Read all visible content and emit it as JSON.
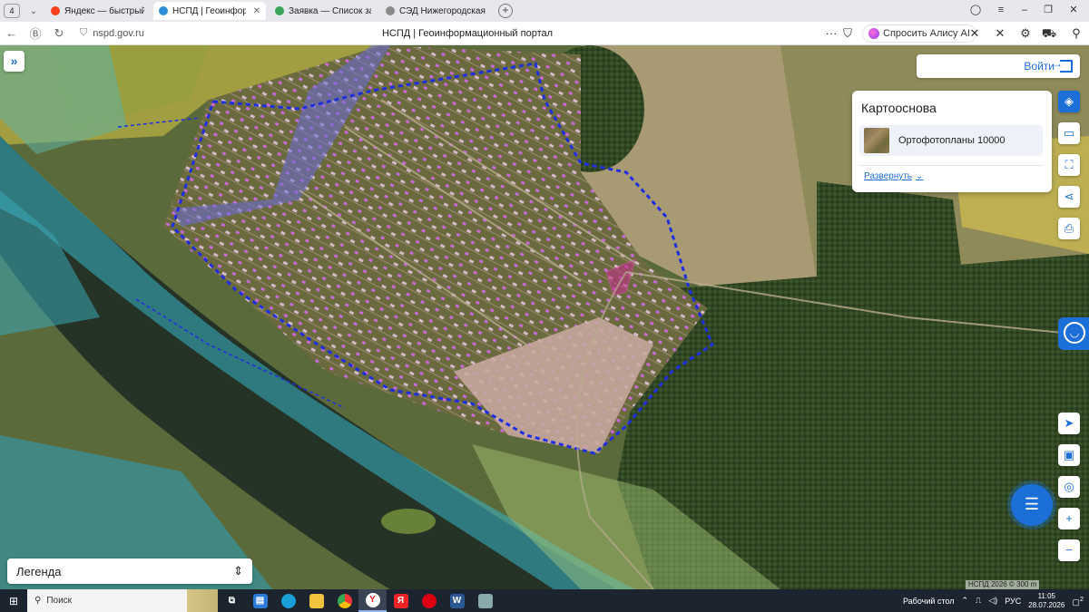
{
  "browser": {
    "tab_count": "4",
    "tabs": [
      {
        "label": "Яндекс — быстрый поиск",
        "color": "#fc3f1d",
        "active": false
      },
      {
        "label": "НСПД | Геоинформаци",
        "color": "#2a8fd6",
        "active": true
      },
      {
        "label": "Заявка — Список заявок",
        "color": "#3ba55c",
        "active": false
      },
      {
        "label": "СЭД Нижегородская обл",
        "color": "#8a8a8a",
        "active": false
      }
    ],
    "url": "nspd.gov.ru",
    "page_title": "НСПД | Геоинформационный портал",
    "alice_label": "Спросить Алису AI"
  },
  "map": {
    "login_label": "Войти",
    "basemap": {
      "title": "Картооснова",
      "item_label": "Ортофотопланы 10000",
      "expand_label": "Развернуть"
    },
    "legend_label": "Легенда",
    "scale_text": "НСПД 2026 ©          300 m"
  },
  "taskbar": {
    "search_label": "Поиск",
    "desktop_label": "Рабочий стол",
    "lang": "РУС",
    "time": "11:05",
    "date": "28.07.2026",
    "notif_count": "2"
  },
  "icons": {
    "expand": "double-chevron-right-icon",
    "login": "login-arrow-icon",
    "chat": "chat-bubble-icon"
  }
}
